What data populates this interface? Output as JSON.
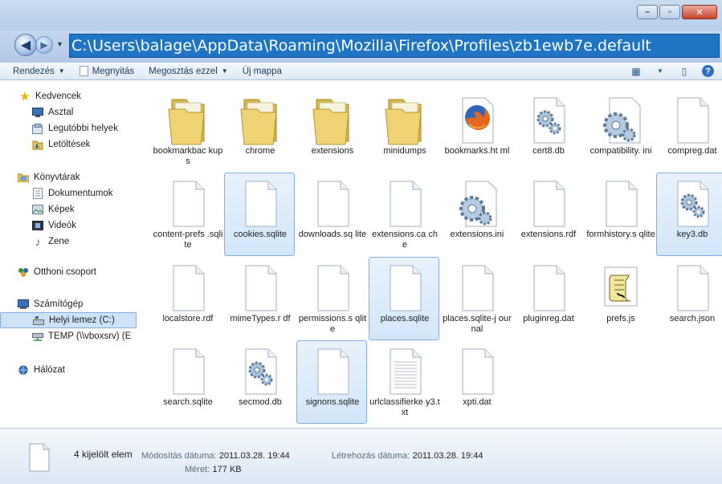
{
  "window": {
    "address": "C:\\Users\\balage\\AppData\\Roaming\\Mozilla\\Firefox\\Profiles\\zb1ewb7e.default",
    "min_btn": "–",
    "max_btn": "▫",
    "close_btn": "✕"
  },
  "toolbar": {
    "organize": "Rendezés",
    "open": "Megnyitás",
    "share": "Megosztás ezzel",
    "new_folder": "Új mappa"
  },
  "sidebar": {
    "favorites": {
      "label": "Kedvencek",
      "items": [
        "Asztal",
        "Legutóbbi helyek",
        "Letöltések"
      ]
    },
    "libraries": {
      "label": "Könyvtárak",
      "items": [
        "Dokumentumok",
        "Képek",
        "Videók",
        "Zene"
      ]
    },
    "homegroup": {
      "label": "Otthoni csoport"
    },
    "computer": {
      "label": "Számítógép",
      "items": [
        "Helyi lemez (C:)",
        "TEMP (\\\\vboxsrv) (E"
      ]
    },
    "network": {
      "label": "Hálózat"
    }
  },
  "files": [
    {
      "label": "bookmarkbac kups",
      "icon": "folder-icon"
    },
    {
      "label": "chrome",
      "icon": "folder-icon"
    },
    {
      "label": "extensions",
      "icon": "folder-icon"
    },
    {
      "label": "minidumps",
      "icon": "folder-icon"
    },
    {
      "label": "bookmarks.ht ml",
      "icon": "firefox-icon"
    },
    {
      "label": "cert8.db",
      "icon": "gear-file-icon"
    },
    {
      "label": "compatibility. ini",
      "icon": "gear-icon"
    },
    {
      "label": "compreg.dat",
      "icon": "blank-file-icon"
    },
    {
      "label": "content-prefs .sqlite",
      "icon": "blank-file-icon"
    },
    {
      "label": "cookies.sqlite",
      "icon": "blank-file-icon",
      "selected": true
    },
    {
      "label": "downloads.sq lite",
      "icon": "blank-file-icon"
    },
    {
      "label": "extensions.ca che",
      "icon": "blank-file-icon"
    },
    {
      "label": "extensions.ini",
      "icon": "gear-icon"
    },
    {
      "label": "extensions.rdf",
      "icon": "blank-file-icon"
    },
    {
      "label": "formhistory.s qlite",
      "icon": "blank-file-icon"
    },
    {
      "label": "key3.db",
      "icon": "gear-file-icon",
      "selected": true
    },
    {
      "label": "localstore.rdf",
      "icon": "blank-file-icon"
    },
    {
      "label": "mimeTypes.r df",
      "icon": "blank-file-icon"
    },
    {
      "label": "permissions.s qlite",
      "icon": "blank-file-icon"
    },
    {
      "label": "places.sqlite",
      "icon": "blank-file-icon",
      "selected": true
    },
    {
      "label": "places.sqlite-j ournal",
      "icon": "blank-file-icon"
    },
    {
      "label": "pluginreg.dat",
      "icon": "blank-file-icon"
    },
    {
      "label": "prefs.js",
      "icon": "script-icon"
    },
    {
      "label": "search.json",
      "icon": "blank-file-icon"
    },
    {
      "label": "search.sqlite",
      "icon": "blank-file-icon"
    },
    {
      "label": "secmod.db",
      "icon": "gear-file-icon"
    },
    {
      "label": "signons.sqlite",
      "icon": "blank-file-icon",
      "selected": true
    },
    {
      "label": "urlclassifierke y3.txt",
      "icon": "text-file-icon"
    },
    {
      "label": "xpti.dat",
      "icon": "blank-file-icon"
    }
  ],
  "status": {
    "count": "4 kijelölt elem",
    "modified_label": "Módosítás dátuma:",
    "modified_value": "2011.03.28. 19:44",
    "size_label": "Méret:",
    "size_value": "177 KB",
    "created_label": "Létrehozás dátuma:",
    "created_value": "2011.03.28. 19:44"
  }
}
